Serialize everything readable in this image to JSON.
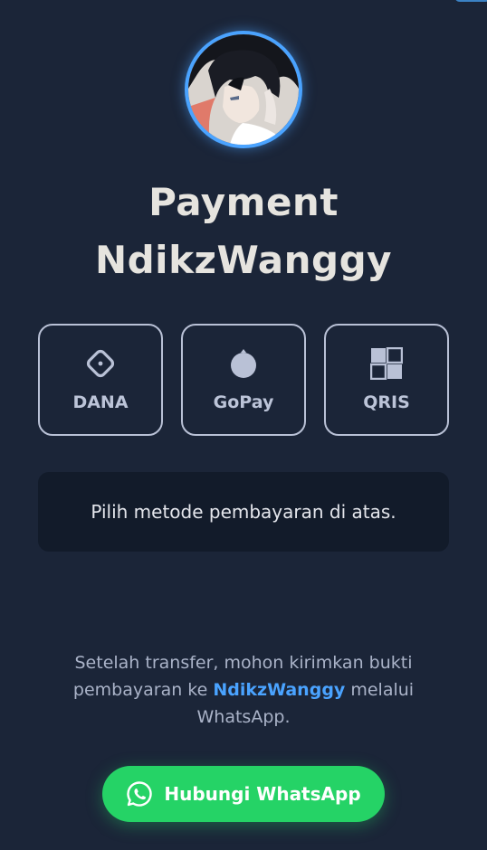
{
  "header": {
    "title_line1": "Payment",
    "title_line2": "NdikzWanggy"
  },
  "methods": [
    {
      "label": "DANA",
      "icon": "diamond-icon"
    },
    {
      "label": "GoPay",
      "icon": "circle-drop-icon"
    },
    {
      "label": "QRIS",
      "icon": "qr-grid-icon"
    }
  ],
  "info": {
    "text": "Pilih metode pembayaran di atas."
  },
  "note": {
    "before": "Setelah transfer, mohon kirimkan bukti pembayaran ke ",
    "highlight": "NdikzWanggy",
    "after": " melalui WhatsApp."
  },
  "contact": {
    "label": "Hubungi WhatsApp",
    "icon": "whatsapp-icon"
  },
  "colors": {
    "background": "#1b2538",
    "accent": "#4aa3ff",
    "whatsapp": "#25d366"
  }
}
